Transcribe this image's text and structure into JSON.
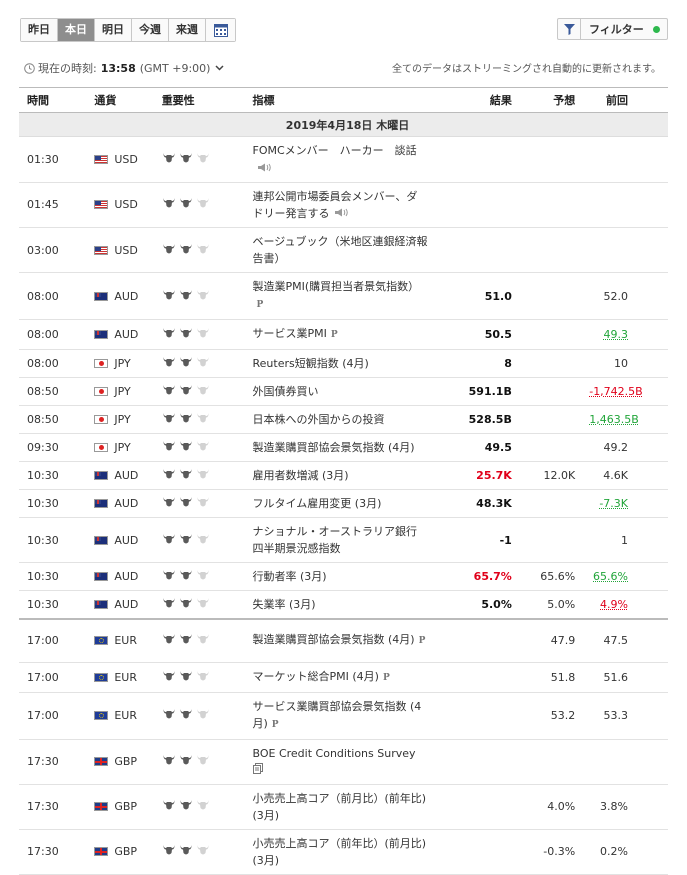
{
  "tabs": [
    "昨日",
    "本日",
    "明日",
    "今週",
    "来週"
  ],
  "active_tab": 1,
  "filter_label": "フィルター",
  "time_label": "現在の時刻:",
  "time_value": "13:58",
  "tz": "(GMT +9:00)",
  "stream_text": "全てのデータはストリーミングされ自動的に更新されます。",
  "columns": {
    "time": "時間",
    "currency": "通貨",
    "importance": "重要性",
    "indicator": "指標",
    "actual": "結果",
    "forecast": "予想",
    "previous": "前回"
  },
  "date": "2019年4月18日 木曜日",
  "events": [
    {
      "time": "01:30",
      "cur": "USD",
      "flag": "usd",
      "imp": 2,
      "name": "FOMCメンバー　ハーカー　談話",
      "icon": "speaker",
      "actual": "",
      "act_color": "",
      "forecast": "",
      "prev": "",
      "prev_color": ""
    },
    {
      "time": "01:45",
      "cur": "USD",
      "flag": "usd",
      "imp": 2,
      "name": "連邦公開市場委員会メンバー、ダドリー発言する",
      "icon": "speaker",
      "actual": "",
      "act_color": "",
      "forecast": "",
      "prev": "",
      "prev_color": ""
    },
    {
      "time": "03:00",
      "cur": "USD",
      "flag": "usd",
      "imp": 2,
      "name": "ベージュブック（米地区連銀経済報告書）",
      "icon": "",
      "actual": "",
      "act_color": "",
      "forecast": "",
      "prev": "",
      "prev_color": ""
    },
    {
      "time": "08:00",
      "cur": "AUD",
      "flag": "aud",
      "imp": 2,
      "name": "製造業PMI(購買担当者景気指数）",
      "icon": "P",
      "actual": "51.0",
      "act_color": "",
      "forecast": "",
      "prev": "52.0",
      "prev_color": ""
    },
    {
      "time": "08:00",
      "cur": "AUD",
      "flag": "aud",
      "imp": 2,
      "name": "サービス業PMI",
      "icon": "P",
      "actual": "50.5",
      "act_color": "",
      "forecast": "",
      "prev": "49.3",
      "prev_color": "green"
    },
    {
      "time": "08:00",
      "cur": "JPY",
      "flag": "jpy",
      "imp": 2,
      "name": "Reuters短観指数 (4月)",
      "icon": "",
      "actual": "8",
      "act_color": "",
      "forecast": "",
      "prev": "10",
      "prev_color": ""
    },
    {
      "time": "08:50",
      "cur": "JPY",
      "flag": "jpy",
      "imp": 2,
      "name": "外国債券買い",
      "icon": "",
      "actual": "591.1B",
      "act_color": "",
      "forecast": "",
      "prev": "-1,742.5B",
      "prev_color": "red"
    },
    {
      "time": "08:50",
      "cur": "JPY",
      "flag": "jpy",
      "imp": 2,
      "name": "日本株への外国からの投資",
      "icon": "",
      "actual": "528.5B",
      "act_color": "",
      "forecast": "",
      "prev": "1,463.5B",
      "prev_color": "green"
    },
    {
      "time": "09:30",
      "cur": "JPY",
      "flag": "jpy",
      "imp": 2,
      "name": "製造業購買部協会景気指数 (4月)",
      "icon": "",
      "actual": "49.5",
      "act_color": "",
      "forecast": "",
      "prev": "49.2",
      "prev_color": ""
    },
    {
      "time": "10:30",
      "cur": "AUD",
      "flag": "aud",
      "imp": 2,
      "name": "雇用者数増減 (3月)",
      "icon": "",
      "actual": "25.7K",
      "act_color": "red",
      "forecast": "12.0K",
      "prev": "4.6K",
      "prev_color": ""
    },
    {
      "time": "10:30",
      "cur": "AUD",
      "flag": "aud",
      "imp": 2,
      "name": "フルタイム雇用変更 (3月)",
      "icon": "",
      "actual": "48.3K",
      "act_color": "",
      "forecast": "",
      "prev": "-7.3K",
      "prev_color": "green"
    },
    {
      "time": "10:30",
      "cur": "AUD",
      "flag": "aud",
      "imp": 2,
      "name": "ナショナル・オーストラリア銀行　四半期景況感指数",
      "icon": "",
      "actual": "-1",
      "act_color": "",
      "forecast": "",
      "prev": "1",
      "prev_color": ""
    },
    {
      "time": "10:30",
      "cur": "AUD",
      "flag": "aud",
      "imp": 2,
      "name": "行動者率 (3月)",
      "icon": "",
      "actual": "65.7%",
      "act_color": "red",
      "forecast": "65.6%",
      "prev": "65.6%",
      "prev_color": "green"
    },
    {
      "time": "10:30",
      "cur": "AUD",
      "flag": "aud",
      "imp": 2,
      "name": "失業率 (3月)",
      "icon": "",
      "actual": "5.0%",
      "act_color": "",
      "forecast": "5.0%",
      "prev": "4.9%",
      "prev_color": "red"
    },
    {
      "time": "17:00",
      "cur": "EUR",
      "flag": "eur",
      "imp": 2,
      "name": "製造業購買部協会景気指数 (4月)",
      "icon": "P",
      "actual": "",
      "act_color": "",
      "forecast": "47.9",
      "prev": "47.5",
      "prev_color": "",
      "sep": true
    },
    {
      "time": "17:00",
      "cur": "EUR",
      "flag": "eur",
      "imp": 2,
      "name": "マーケット総合PMI (4月)",
      "icon": "P",
      "actual": "",
      "act_color": "",
      "forecast": "51.8",
      "prev": "51.6",
      "prev_color": ""
    },
    {
      "time": "17:00",
      "cur": "EUR",
      "flag": "eur",
      "imp": 2,
      "name": "サービス業購買部協会景気指数 (4月)",
      "icon": "P",
      "actual": "",
      "act_color": "",
      "forecast": "53.2",
      "prev": "53.3",
      "prev_color": ""
    },
    {
      "time": "17:30",
      "cur": "GBP",
      "flag": "gbp",
      "imp": 2,
      "name": "BOE Credit Conditions Survey",
      "icon": "doc",
      "actual": "",
      "act_color": "",
      "forecast": "",
      "prev": "",
      "prev_color": ""
    },
    {
      "time": "17:30",
      "cur": "GBP",
      "flag": "gbp",
      "imp": 2,
      "name": "小売売上高コア（前月比）(前年比) (3月)",
      "icon": "",
      "actual": "",
      "act_color": "",
      "forecast": "4.0%",
      "prev": "3.8%",
      "prev_color": ""
    },
    {
      "time": "17:30",
      "cur": "GBP",
      "flag": "gbp",
      "imp": 2,
      "name": "小売売上高コア（前年比）(前月比) (3月)",
      "icon": "",
      "actual": "",
      "act_color": "",
      "forecast": "-0.3%",
      "prev": "0.2%",
      "prev_color": ""
    }
  ]
}
